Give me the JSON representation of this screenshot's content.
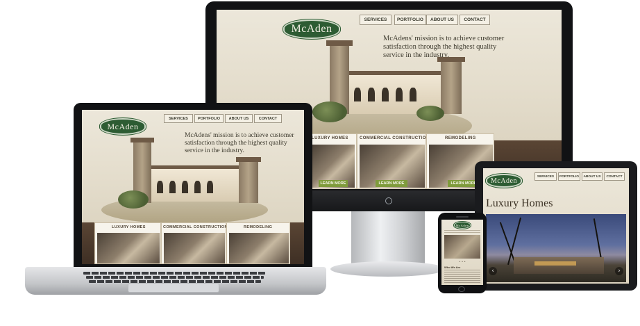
{
  "site": {
    "logo": "McAden",
    "nav": [
      "SERVICES",
      "PORTFOLIO",
      "ABOUT US",
      "CONTACT"
    ],
    "mission": "McAdens' mission is to achieve customer satisfaction through the highest quality service in the industry.",
    "tiles": [
      "LUXURY HOMES",
      "COMMERCIAL CONSTRUCTION",
      "REMODELING"
    ],
    "learn_more": "LEARN MORE"
  },
  "tablet": {
    "heading": "Luxury Homes",
    "prev_arrow": "‹",
    "next_arrow": "›"
  },
  "phone": {
    "dots": "• • •",
    "section_title": "Who We Are"
  },
  "colors": {
    "brand_green": "#2d5c33",
    "accent_green": "#7f9b3c",
    "paper": "#e6e0d0",
    "brown": "#4b3a2c"
  }
}
